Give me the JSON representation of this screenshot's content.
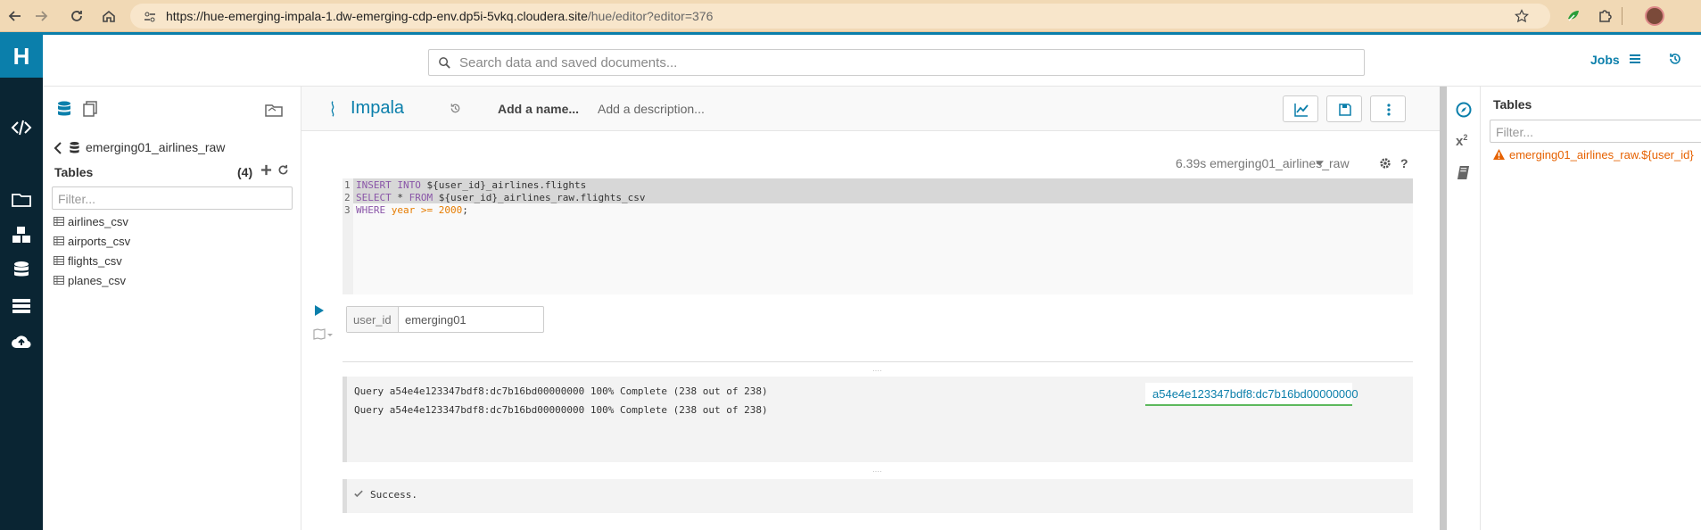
{
  "browser": {
    "url_host": "https://hue-emerging-impala-1.dw-emerging-cdp-env.dp5i-5vkq.cloudera.site",
    "url_path": "/hue/editor?editor=376",
    "icons": [
      "back-icon",
      "forward-icon",
      "reload-icon",
      "home-icon",
      "site-info-icon",
      "bookmark-star-icon",
      "extension-icon",
      "puzzle-icon",
      "profile-avatar"
    ]
  },
  "header": {
    "search_placeholder": "Search data and saved documents...",
    "jobs_label": "Jobs"
  },
  "assist": {
    "database": "emerging01_airlines_raw",
    "tables_label": "Tables",
    "tables_count": "(4)",
    "filter_placeholder": "Filter...",
    "tables": [
      "airlines_csv",
      "airports_csv",
      "flights_csv",
      "planes_csv"
    ]
  },
  "editor": {
    "engine": "Impala",
    "name_placeholder": "Add a name...",
    "description_placeholder": "Add a description...",
    "exec_info": "6.39s emerging01_airlines_raw",
    "code_lines": [
      {
        "n": "1",
        "parts": [
          [
            "kw",
            "INSERT INTO "
          ],
          [
            "t",
            "${user_id}_airlines.flights"
          ]
        ]
      },
      {
        "n": "2",
        "parts": [
          [
            "kw",
            "SELECT "
          ],
          [
            "t",
            "* "
          ],
          [
            "kw",
            "FROM "
          ],
          [
            "t",
            "${user_id}_airlines_raw.flights_csv"
          ]
        ]
      },
      {
        "n": "3",
        "parts": [
          [
            "kw",
            "WHERE "
          ],
          [
            "num",
            "year >= 2000"
          ],
          [
            "t",
            ";"
          ]
        ]
      }
    ],
    "param_label": "user_id",
    "param_value": "emerging01",
    "log_lines": [
      "Query a54e4e123347bdf8:dc7b16bd00000000 100% Complete (238 out of 238)",
      "Query a54e4e123347bdf8:dc7b16bd00000000 100% Complete (238 out of 238)"
    ],
    "query_id_link": "a54e4e123347bdf8:dc7b16bd00000000",
    "success_text": "Success."
  },
  "right_panel": {
    "tables_label": "Tables",
    "filter_placeholder": "Filter...",
    "warning_item": "emerging01_airlines_raw.${user_id}"
  },
  "colors": {
    "accent": "#0b7fab",
    "nav_bg": "#0a2533",
    "warning": "#e66100",
    "link_underline": "#5cb85c"
  }
}
